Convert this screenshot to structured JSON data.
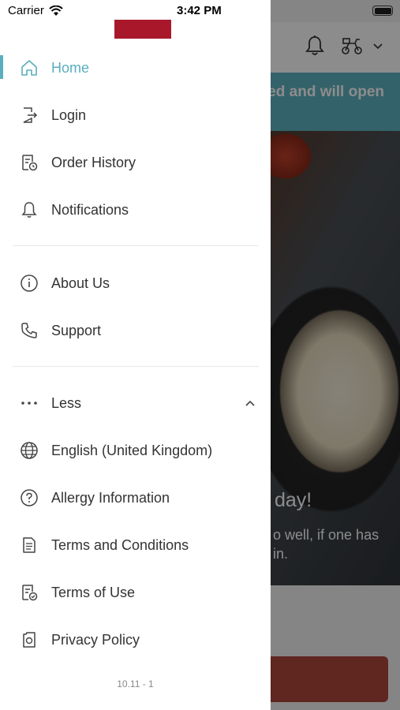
{
  "status_bar": {
    "carrier": "Carrier",
    "time": "3:42 PM"
  },
  "background": {
    "banner_text": "ed and will open",
    "hero_title": "day!",
    "hero_text": "o well, if one has in."
  },
  "drawer": {
    "active_color": "#5aaebd",
    "brand_color": "#a8182a",
    "primary_items": [
      {
        "label": "Home",
        "icon": "home-icon",
        "active": true
      },
      {
        "label": "Login",
        "icon": "login-icon"
      },
      {
        "label": "Order History",
        "icon": "order-history-icon"
      },
      {
        "label": "Notifications",
        "icon": "bell-icon"
      }
    ],
    "secondary_items": [
      {
        "label": "About Us",
        "icon": "info-icon"
      },
      {
        "label": "Support",
        "icon": "phone-icon"
      }
    ],
    "more_toggle": {
      "label": "Less",
      "icon": "more-dots-icon",
      "expanded": true
    },
    "more_items": [
      {
        "label": "English (United Kingdom)",
        "icon": "globe-icon"
      },
      {
        "label": "Allergy Information",
        "icon": "question-icon"
      },
      {
        "label": "Terms and Conditions",
        "icon": "document-icon"
      },
      {
        "label": "Terms of Use",
        "icon": "document-check-icon"
      },
      {
        "label": "Privacy Policy",
        "icon": "privacy-icon"
      }
    ],
    "version": "10.11 - 1"
  }
}
